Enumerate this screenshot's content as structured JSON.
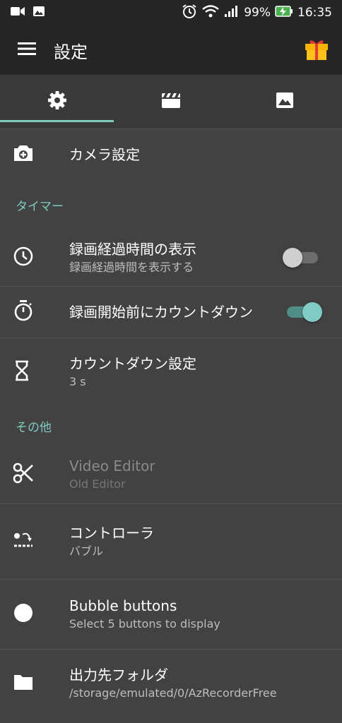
{
  "status_bar": {
    "battery": "99%",
    "time": "16:35"
  },
  "app_bar": {
    "title": "設定"
  },
  "tabs": [
    {
      "icon": "gear-icon",
      "active": true
    },
    {
      "icon": "clapperboard-icon",
      "active": false
    },
    {
      "icon": "image-icon",
      "active": false
    }
  ],
  "settings": {
    "camera": {
      "title": "カメラ設定"
    },
    "timer_section": "タイマー",
    "elapsed_time": {
      "title": "録画経過時間の表示",
      "subtitle": "録画経過時間を表示する",
      "enabled": false
    },
    "countdown": {
      "title": "録画開始前にカウントダウン",
      "enabled": true
    },
    "countdown_setting": {
      "title": "カウントダウン設定",
      "subtitle": "3 s"
    },
    "other_section": "その他",
    "video_editor": {
      "title": "Video Editor",
      "subtitle": "Old Editor"
    },
    "controller": {
      "title": "コントローラ",
      "subtitle": "バブル"
    },
    "bubble_buttons": {
      "title": "Bubble buttons",
      "subtitle": "Select 5 buttons to display"
    },
    "output_folder": {
      "title": "出力先フォルダ",
      "subtitle": "/storage/emulated/0/AzRecorderFree"
    }
  },
  "colors": {
    "accent": "#7fcbc0",
    "background": "#424242",
    "appbar": "#262626"
  }
}
